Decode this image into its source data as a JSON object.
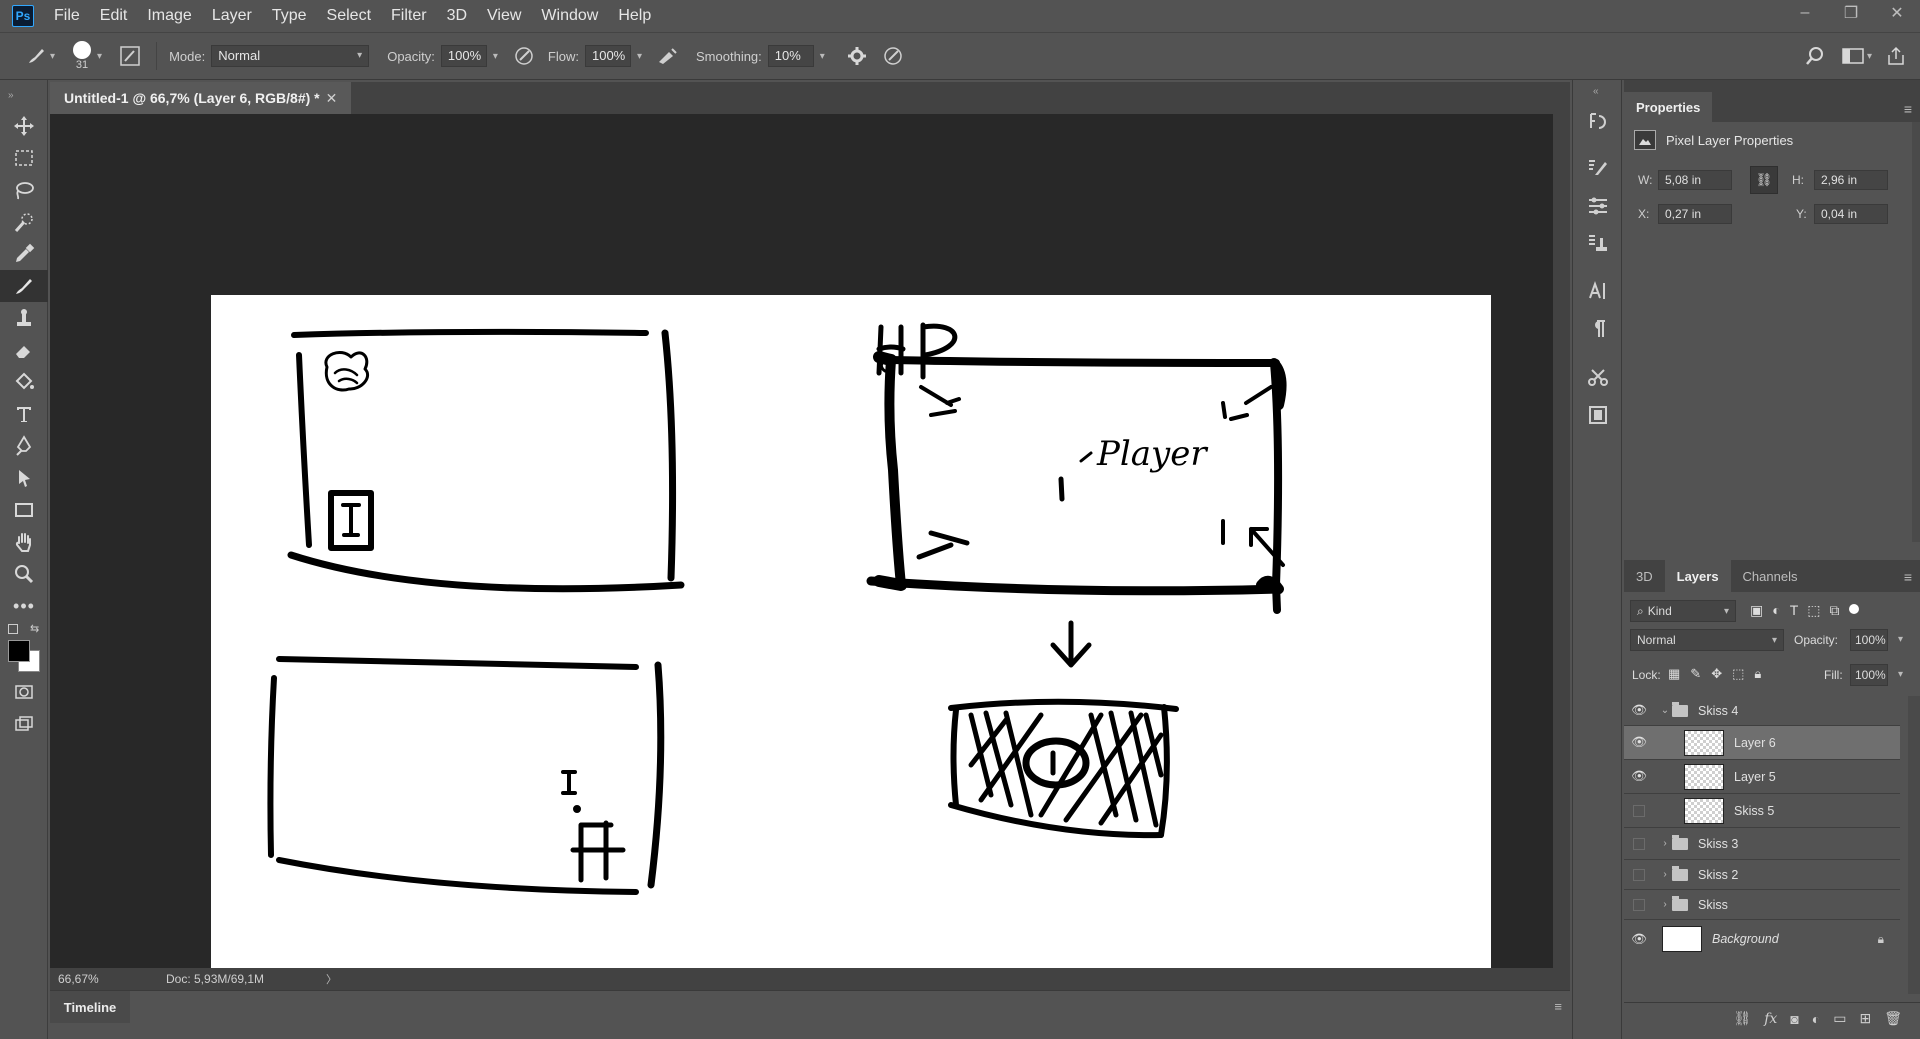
{
  "app": {
    "logo": "Ps"
  },
  "menu": [
    "File",
    "Edit",
    "Image",
    "Layer",
    "Type",
    "Select",
    "Filter",
    "3D",
    "View",
    "Window",
    "Help"
  ],
  "window_controls": {
    "minimize": "–",
    "restore": "❐",
    "close": "✕"
  },
  "options": {
    "brush_size": "31",
    "mode_label": "Mode:",
    "mode_value": "Normal",
    "opacity_label": "Opacity:",
    "opacity_value": "100%",
    "flow_label": "Flow:",
    "flow_value": "100%",
    "smoothing_label": "Smoothing:",
    "smoothing_value": "10%"
  },
  "document": {
    "tab_title": "Untitled-1 @ 66,7% (Layer 6, RGB/8#) *",
    "close": "✕",
    "zoom": "66,67%",
    "doc_info": "Doc: 5,93M/69,1M",
    "status_arrow": "〉"
  },
  "sketch": {
    "hp_label": "HP",
    "player_label": "Player"
  },
  "timeline": {
    "label": "Timeline"
  },
  "properties": {
    "tab": "Properties",
    "header": "Pixel Layer Properties",
    "w_label": "W:",
    "w_value": "5,08 in",
    "h_label": "H:",
    "h_value": "2,96 in",
    "x_label": "X:",
    "x_value": "0,27 in",
    "y_label": "Y:",
    "y_value": "0,04 in"
  },
  "layers_panel": {
    "tabs": [
      "3D",
      "Layers",
      "Channels"
    ],
    "kind_label": "Kind",
    "blend_mode": "Normal",
    "opacity_label": "Opacity:",
    "opacity_value": "100%",
    "lock_label": "Lock:",
    "fill_label": "Fill:",
    "fill_value": "100%",
    "layers": [
      {
        "name": "Skiss 4",
        "type": "group",
        "visible": true,
        "expanded": true
      },
      {
        "name": "Layer 6",
        "type": "layer",
        "visible": true,
        "selected": true
      },
      {
        "name": "Layer 5",
        "type": "layer",
        "visible": true
      },
      {
        "name": "Skiss 5",
        "type": "layer",
        "visible": false
      },
      {
        "name": "Skiss 3",
        "type": "group",
        "visible": false
      },
      {
        "name": "Skiss 2",
        "type": "group",
        "visible": false
      },
      {
        "name": "Skiss",
        "type": "group",
        "visible": false
      },
      {
        "name": "Background",
        "type": "background",
        "visible": true,
        "locked": true
      }
    ]
  }
}
